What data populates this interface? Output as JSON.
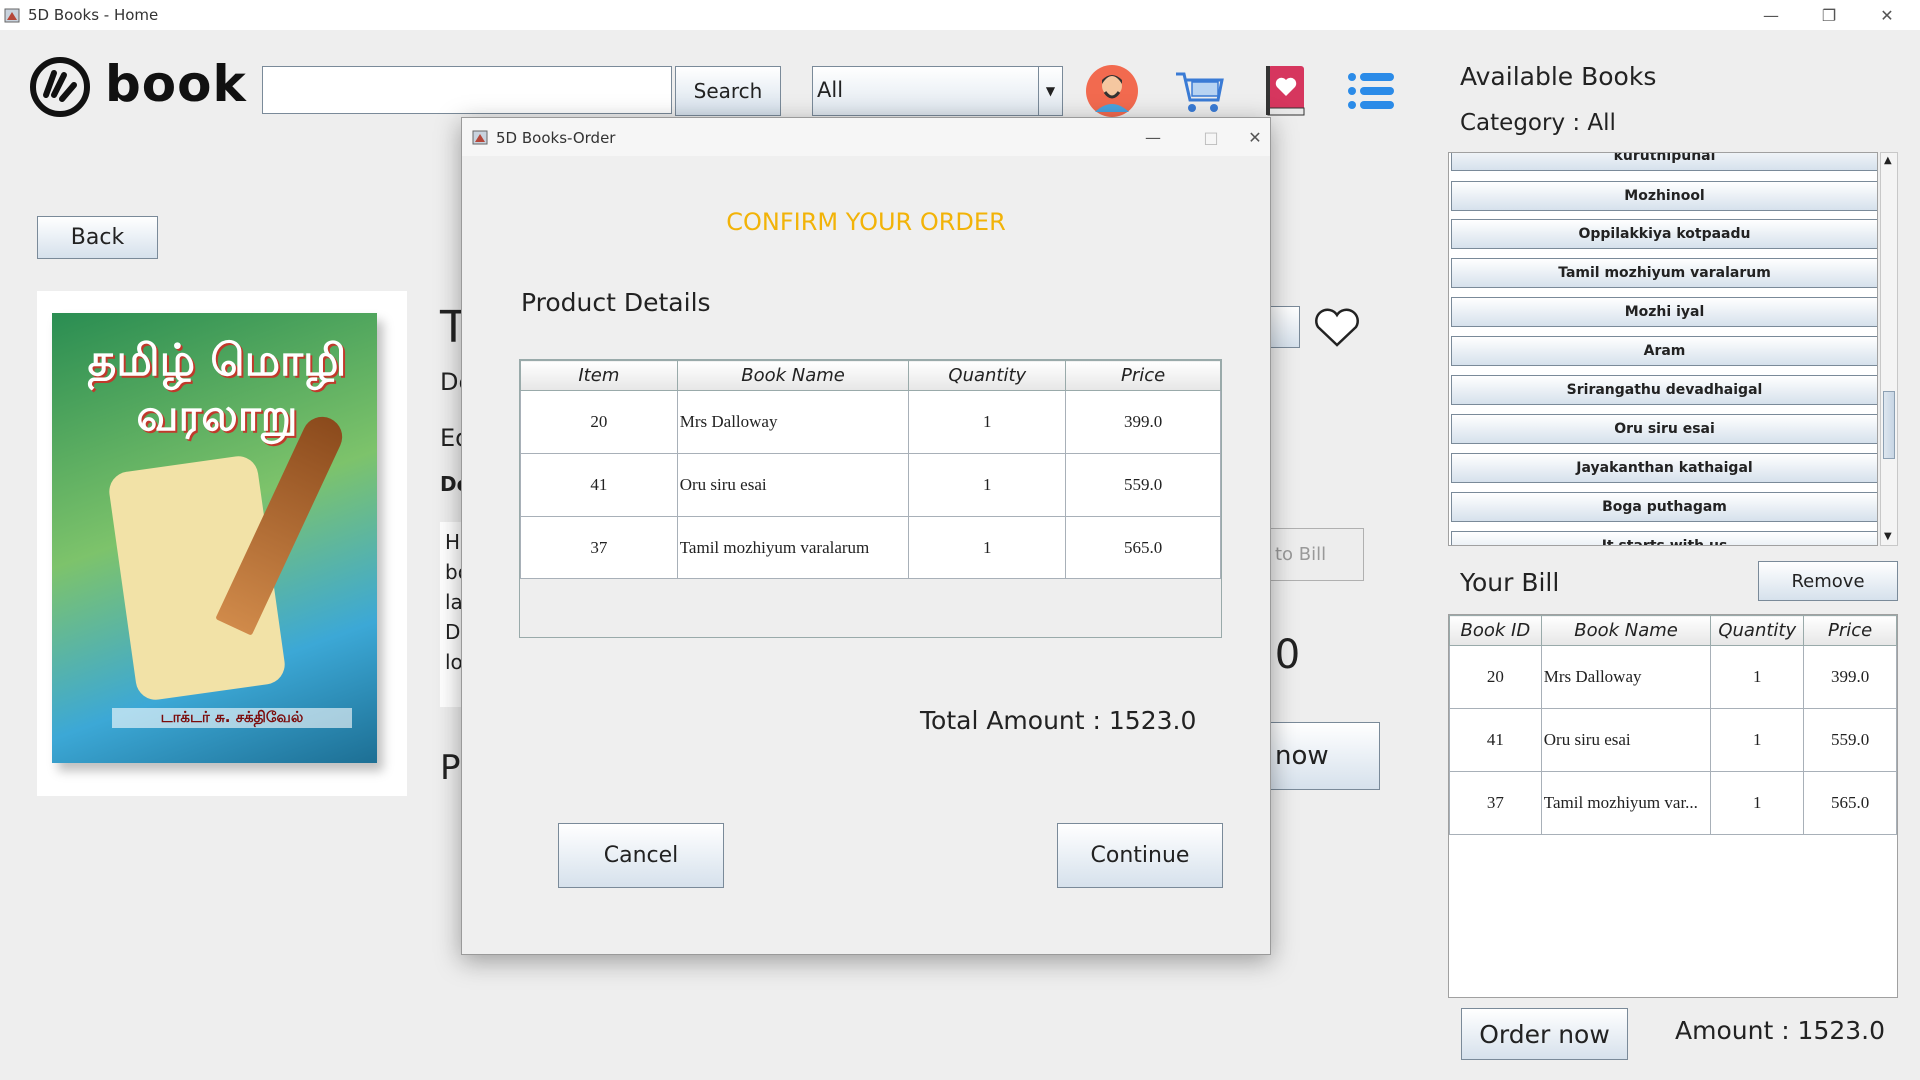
{
  "window": {
    "title": "5D Books - Home"
  },
  "header": {
    "logo_text": "book",
    "search_value": "",
    "search_label": "Search",
    "category_selected": "All"
  },
  "left": {
    "back_label": "Back",
    "title_fragment": "T",
    "desc_fragment": "De",
    "edition_fragment": "Ed",
    "details_fragment": "De",
    "body_lines": [
      "Hi",
      "bo",
      "la",
      "D",
      "lo"
    ],
    "price_fragment": "P",
    "cover_title": "தமிழ் மொழி வரலாறு",
    "cover_author": "டாக்டர் சு. சக்திவேல்",
    "add_to_bill_fragment": "to Bill",
    "price_value_fragment": ".0",
    "buy_now_fragment": "now"
  },
  "right": {
    "available_title": "Available Books",
    "category_label": "Category  :  All",
    "books": [
      "kuruthipunal",
      "Mozhinool",
      "Oppilakkiya kotpaadu",
      "Tamil mozhiyum varalarum",
      "Mozhi iyal",
      "Aram",
      "Srirangathu devadhaigal",
      "Oru siru esai",
      "Jayakanthan kathaigal",
      "Boga puthagam",
      "It starts with us"
    ],
    "bill_title": "Your Bill",
    "remove_label": "Remove",
    "bill_headers": [
      "Book ID",
      "Book Name",
      "Quantity",
      "Price"
    ],
    "bill_rows": [
      [
        "20",
        "Mrs Dalloway",
        "1",
        "399.0"
      ],
      [
        "41",
        "Oru siru esai",
        "1",
        "559.0"
      ],
      [
        "37",
        "Tamil mozhiyum var...",
        "1",
        "565.0"
      ]
    ],
    "order_label": "Order now",
    "amount_text": "Amount :  1523.0"
  },
  "dialog": {
    "title": "5D Books-Order",
    "heading": "CONFIRM YOUR ORDER",
    "product_details": "Product Details",
    "headers": [
      "Item",
      "Book Name",
      "Quantity",
      "Price"
    ],
    "rows": [
      [
        "20",
        "Mrs Dalloway",
        "1",
        "399.0"
      ],
      [
        "41",
        "Oru siru esai",
        "1",
        "559.0"
      ],
      [
        "37",
        "Tamil mozhiyum varalarum",
        "1",
        "565.0"
      ]
    ],
    "total_text": "Total Amount :  1523.0",
    "cancel_label": "Cancel",
    "continue_label": "Continue"
  },
  "colors": {
    "accent_heading": "#f2b308",
    "button_gradient_bottom": "#d6e1ec"
  },
  "icons": [
    "java-app-icon",
    "profile-icon",
    "cart-icon",
    "wishlist-book-icon",
    "menu-list-icon",
    "heart-icon"
  ]
}
